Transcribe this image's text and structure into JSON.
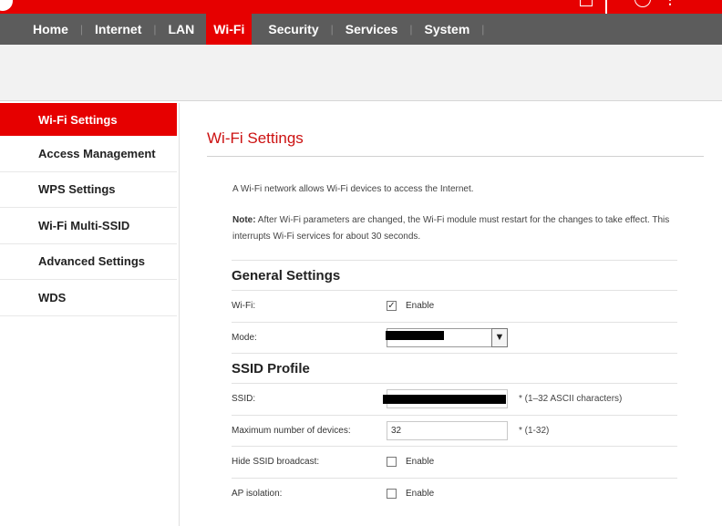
{
  "nav": {
    "items": [
      {
        "label": "Home"
      },
      {
        "label": "Internet"
      },
      {
        "label": "LAN"
      },
      {
        "label": "Wi-Fi",
        "active": true
      },
      {
        "label": "Security"
      },
      {
        "label": "Services"
      },
      {
        "label": "System"
      }
    ],
    "separator": "|"
  },
  "sidebar": {
    "items": [
      {
        "label": "Wi-Fi Settings",
        "active": true
      },
      {
        "label": "Access Management"
      },
      {
        "label": "WPS Settings"
      },
      {
        "label": "Wi-Fi Multi-SSID"
      },
      {
        "label": "Advanced Settings"
      },
      {
        "label": "WDS"
      }
    ]
  },
  "main": {
    "title": "Wi-Fi Settings",
    "intro": "A Wi-Fi network allows Wi-Fi devices to access the Internet.",
    "note_label": "Note:",
    "note_text": " After Wi-Fi parameters are changed, the Wi-Fi module must restart for the changes to take effect. This interrupts Wi-Fi services for about 30 seconds.",
    "general": {
      "heading": "General Settings",
      "wifi_label": "Wi-Fi:",
      "wifi_enable": "Enable",
      "wifi_checked": true,
      "mode_label": "Mode:"
    },
    "ssid_profile": {
      "heading": "SSID Profile",
      "ssid_label": "SSID:",
      "ssid_hint": "* (1–32 ASCII characters)",
      "max_devices_label": "Maximum number of devices:",
      "max_devices_value": "32",
      "max_devices_hint": "* (1-32)",
      "hide_ssid_label": "Hide SSID broadcast:",
      "hide_ssid_enable": "Enable",
      "hide_ssid_checked": false,
      "ap_isolation_label": "AP isolation:",
      "ap_isolation_enable": "Enable",
      "ap_isolation_checked": false
    }
  },
  "colors": {
    "brand_red": "#e60000",
    "nav_grey": "#5c5c5c",
    "title_red": "#cc1111"
  }
}
